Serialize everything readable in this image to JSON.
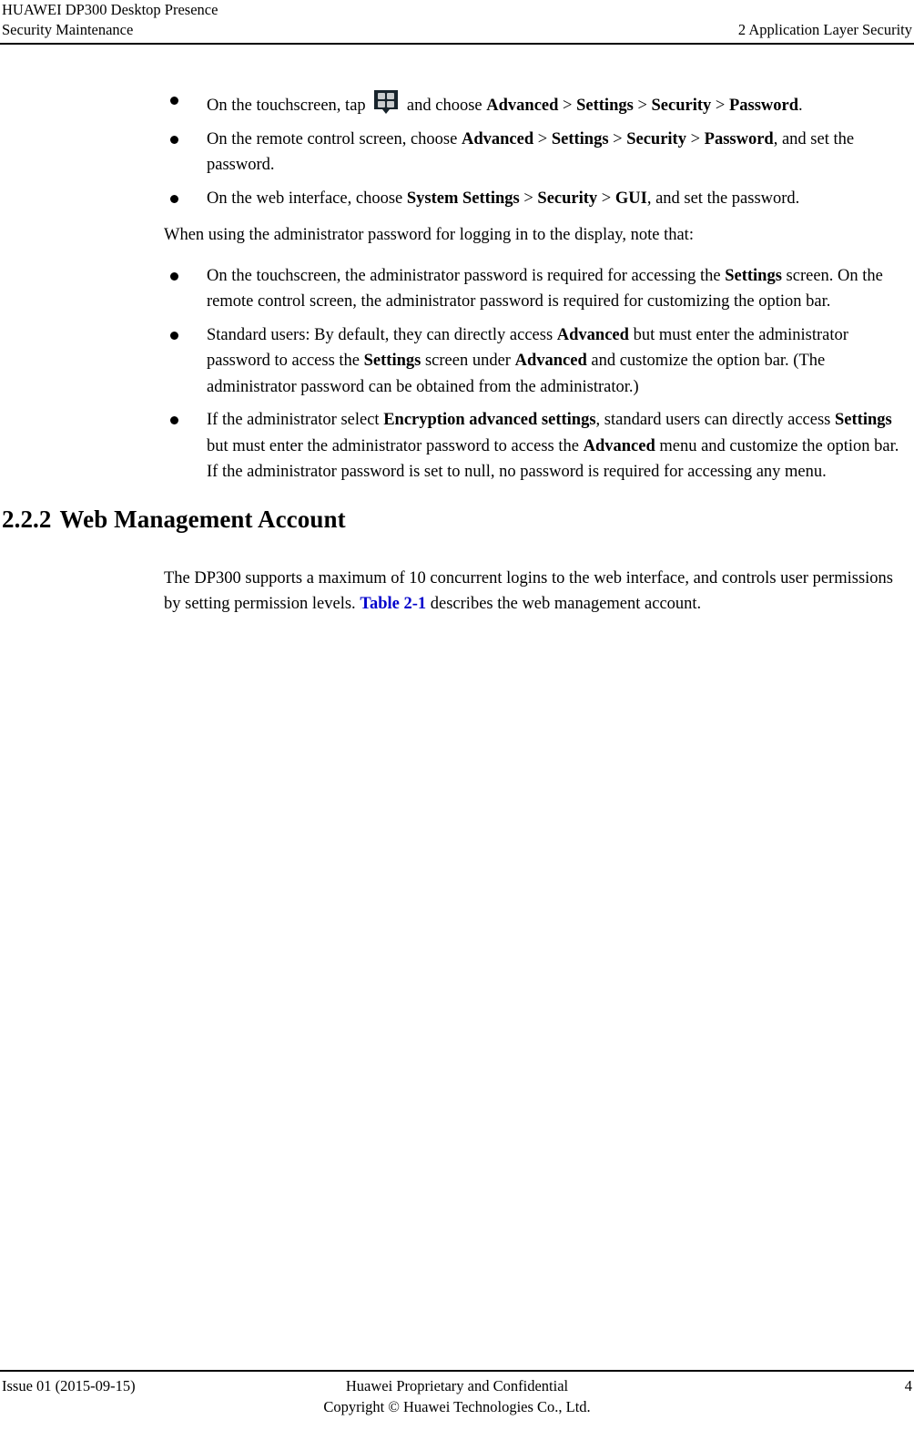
{
  "header": {
    "product_title": "HUAWEI DP300 Desktop Presence",
    "doc_section": "Security Maintenance",
    "chapter": "2 Application Layer Security"
  },
  "bullets_group_1": [
    {
      "id": "touchscreen-password",
      "parts": [
        {
          "t": "On the touchscreen, tap ",
          "b": false
        },
        {
          "t": "__ICON__",
          "b": false
        },
        {
          "t": " and choose ",
          "b": false
        },
        {
          "t": "Advanced",
          "b": true
        },
        {
          "t": " > ",
          "b": false
        },
        {
          "t": "Settings",
          "b": true
        },
        {
          "t": " > ",
          "b": false
        },
        {
          "t": "Security",
          "b": true
        },
        {
          "t": " > ",
          "b": false
        },
        {
          "t": "Password",
          "b": true
        },
        {
          "t": ".",
          "b": false
        }
      ]
    },
    {
      "id": "remote-control-password",
      "parts": [
        {
          "t": "On the remote control screen, choose ",
          "b": false
        },
        {
          "t": "Advanced",
          "b": true
        },
        {
          "t": " > ",
          "b": false
        },
        {
          "t": "Settings",
          "b": true
        },
        {
          "t": " > ",
          "b": false
        },
        {
          "t": "Security",
          "b": true
        },
        {
          "t": " > ",
          "b": false
        },
        {
          "t": "Password",
          "b": true
        },
        {
          "t": ", and set the password.",
          "b": false
        }
      ]
    },
    {
      "id": "web-interface-password",
      "parts": [
        {
          "t": "On the web interface, choose ",
          "b": false
        },
        {
          "t": "System Settings",
          "b": true
        },
        {
          "t": " > ",
          "b": false
        },
        {
          "t": "Security",
          "b": true
        },
        {
          "t": " > ",
          "b": false
        },
        {
          "t": "GUI",
          "b": true
        },
        {
          "t": ", and set the password.",
          "b": false
        }
      ]
    }
  ],
  "intro_paragraph": "When using the administrator password for logging in to the display, note that:",
  "bullets_group_2": [
    {
      "id": "touchscreen-admin-password",
      "parts": [
        {
          "t": "On the touchscreen, the administrator password is required for accessing the ",
          "b": false
        },
        {
          "t": "Settings",
          "b": true
        },
        {
          "t": " screen. On the remote control screen, the administrator password is required for customizing the option bar.",
          "b": false
        }
      ]
    },
    {
      "id": "standard-users",
      "parts": [
        {
          "t": "Standard users: By default, they can directly access ",
          "b": false
        },
        {
          "t": "Advanced",
          "b": true
        },
        {
          "t": " but must enter the administrator password to access the ",
          "b": false
        },
        {
          "t": "Settings",
          "b": true
        },
        {
          "t": " screen under ",
          "b": false
        },
        {
          "t": "Advanced",
          "b": true
        },
        {
          "t": " and customize the option bar. (The administrator password can be obtained from the administrator.)",
          "b": false
        }
      ]
    },
    {
      "id": "encryption-advanced-settings",
      "parts": [
        {
          "t": "If the administrator select ",
          "b": false
        },
        {
          "t": "Encryption advanced settings",
          "b": true
        },
        {
          "t": ", standard users can directly access ",
          "b": false
        },
        {
          "t": "Settings",
          "b": true
        },
        {
          "t": " but must enter the administrator password to access the ",
          "b": false
        },
        {
          "t": "Advanced",
          "b": true
        },
        {
          "t": " menu and customize the option bar. If the administrator password is set to null, no password is required for accessing any menu.",
          "b": false
        }
      ]
    }
  ],
  "section_heading": {
    "number": "2.2.2",
    "title": "Web Management Account"
  },
  "body_paragraph": {
    "parts": [
      {
        "t": "The DP300 supports a maximum of 10 concurrent logins to the web interface, and controls user permissions by setting permission levels. ",
        "b": false,
        "link": false
      },
      {
        "t": "Table 2-1",
        "b": true,
        "link": true
      },
      {
        "t": " describes the web management account.",
        "b": false,
        "link": false
      }
    ]
  },
  "footer": {
    "issue": "Issue 01 (2015-09-15)",
    "confidential_line1": "Huawei Proprietary and Confidential",
    "confidential_line2": "Copyright © Huawei Technologies Co., Ltd.",
    "page_number": "4"
  },
  "icons": {
    "grid_menu": {
      "name": "grid-menu-icon",
      "body_color": "#18242c",
      "tile_color": "#c9ccce"
    }
  },
  "colors": {
    "link": "#0000cc",
    "text": "#000000",
    "rule": "#000000"
  }
}
